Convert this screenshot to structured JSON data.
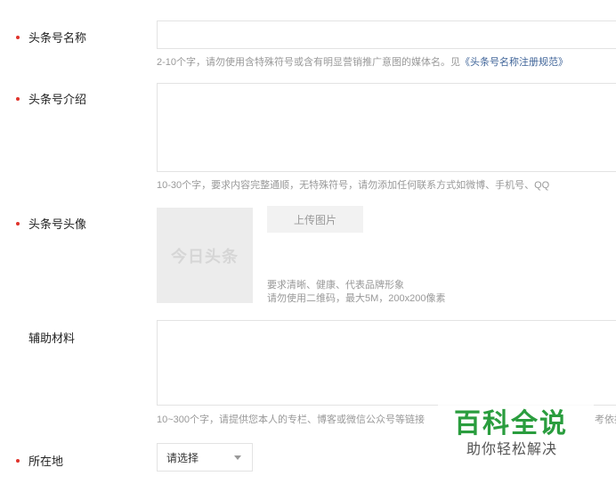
{
  "form": {
    "name": {
      "label": "头条号名称",
      "hint_text": "2-10个字，请勿使用含特殊符号或含有明显营销推广意图的媒体名。见",
      "hint_link": "《头条号名称注册规范》"
    },
    "intro": {
      "label": "头条号介绍",
      "hint": "10-30个字，要求内容完整通顺，无特殊符号，请勿添加任何联系方式如微博、手机号、QQ"
    },
    "avatar": {
      "label": "头条号头像",
      "placeholder_text": "今日头条",
      "upload_label": "上传图片",
      "requirement_1": "要求清晰、健康、代表品牌形象",
      "requirement_2": "请勿使用二维码，最大5M，200x200像素"
    },
    "materials": {
      "label": "辅助材料",
      "hint_left": "10~300个字，请提供您本人的专栏、博客或微信公众号等链接",
      "hint_right": "考依据"
    },
    "location": {
      "label": "所在地",
      "selected": "请选择"
    }
  },
  "watermark": {
    "title": "百科全说",
    "subtitle": "助你轻松解决"
  },
  "colors": {
    "required_dot": "#e0332b",
    "link": "#406599",
    "watermark_green": "#2a9d3e"
  }
}
